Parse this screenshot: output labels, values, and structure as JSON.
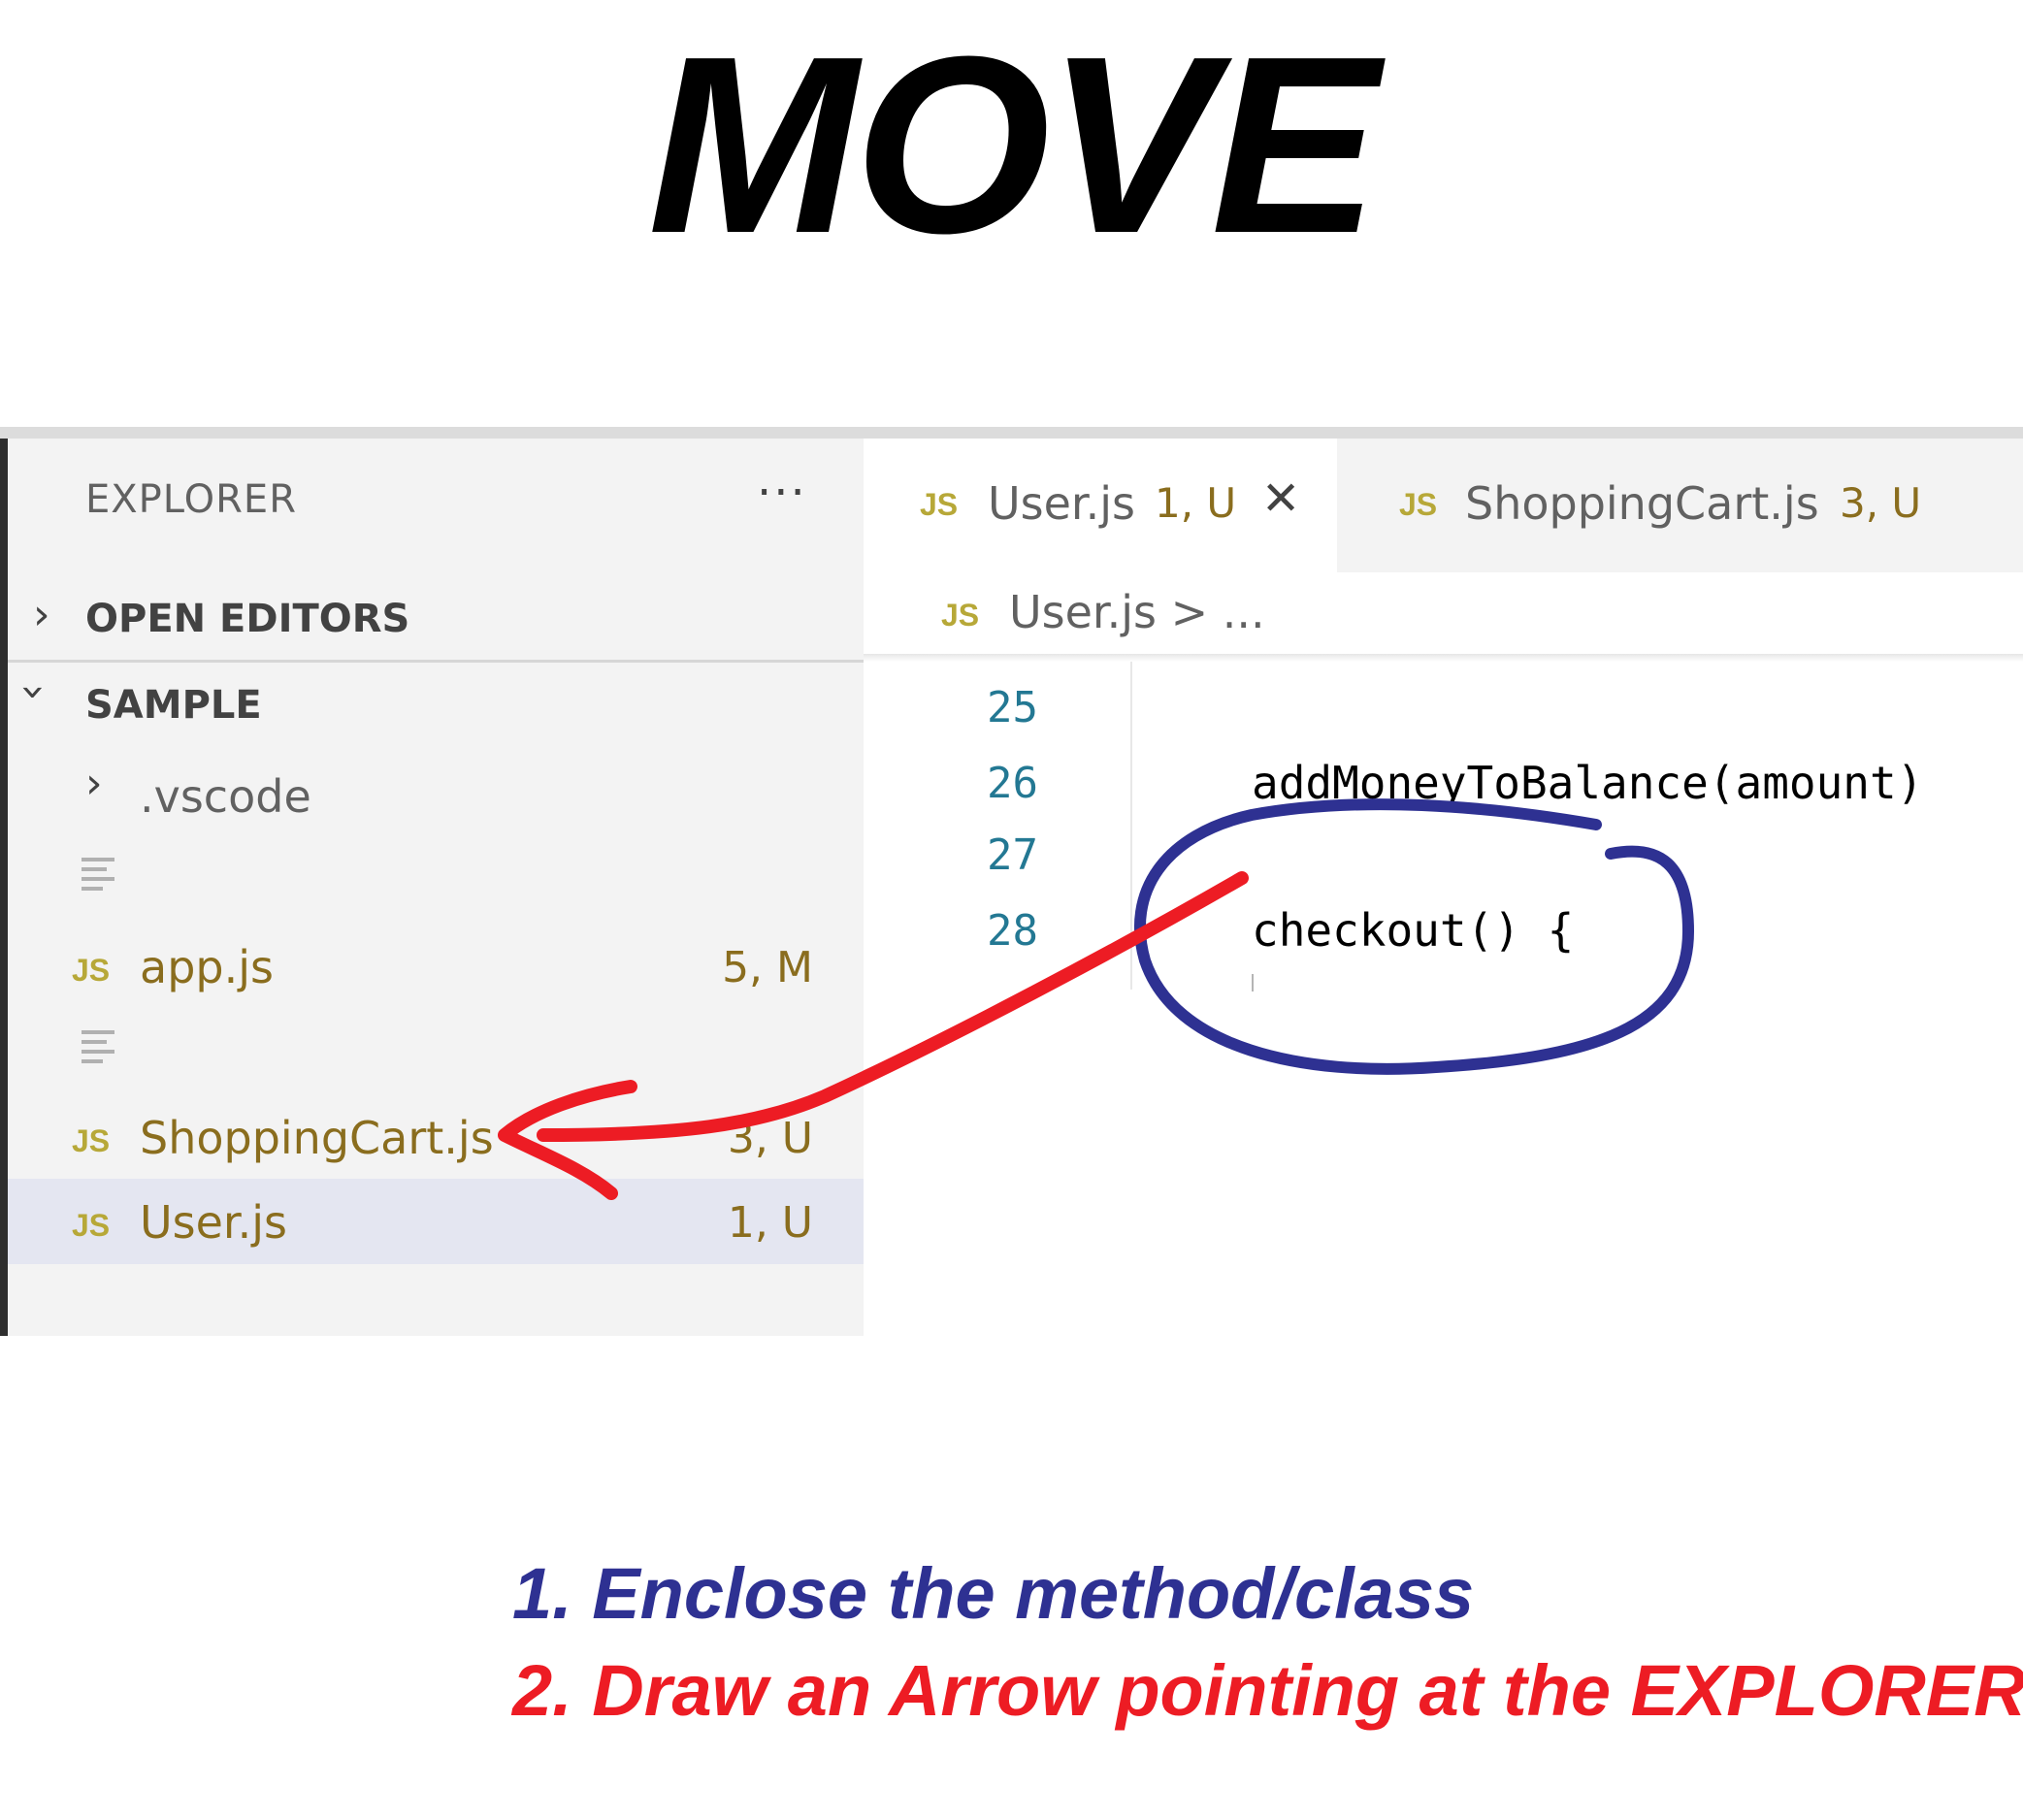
{
  "heading": "MOVE",
  "sidebar": {
    "title": "EXPLORER",
    "more_icon": "···",
    "open_editors": "OPEN EDITORS",
    "project": "SAMPLE",
    "folder": ".vscode",
    "files": [
      {
        "badge": "JS",
        "name": "app.js",
        "status": "5, M"
      },
      {
        "badge": "JS",
        "name": "ShoppingCart.js",
        "status": "3, U"
      },
      {
        "badge": "JS",
        "name": "User.js",
        "status": "1, U"
      }
    ]
  },
  "editor": {
    "tabs": [
      {
        "badge": "JS",
        "name": "User.js",
        "status": "1, U",
        "close": "✕"
      },
      {
        "badge": "JS",
        "name": "ShoppingCart.js",
        "status": "3, U"
      }
    ],
    "breadcrumb": {
      "badge": "JS",
      "path": "User.js > ..."
    },
    "lines": [
      {
        "num": "25",
        "code": ""
      },
      {
        "num": "26",
        "code": "addMoneyToBalance(amount)"
      },
      {
        "num": "27",
        "code": ""
      },
      {
        "num": "28",
        "code": "checkout() {"
      }
    ]
  },
  "instructions": [
    {
      "text": "1. Enclose the method/class",
      "color": "#2e3192"
    },
    {
      "text": "2. Draw an Arrow pointing at the EXPLORER",
      "color": "#ed1c24"
    }
  ]
}
